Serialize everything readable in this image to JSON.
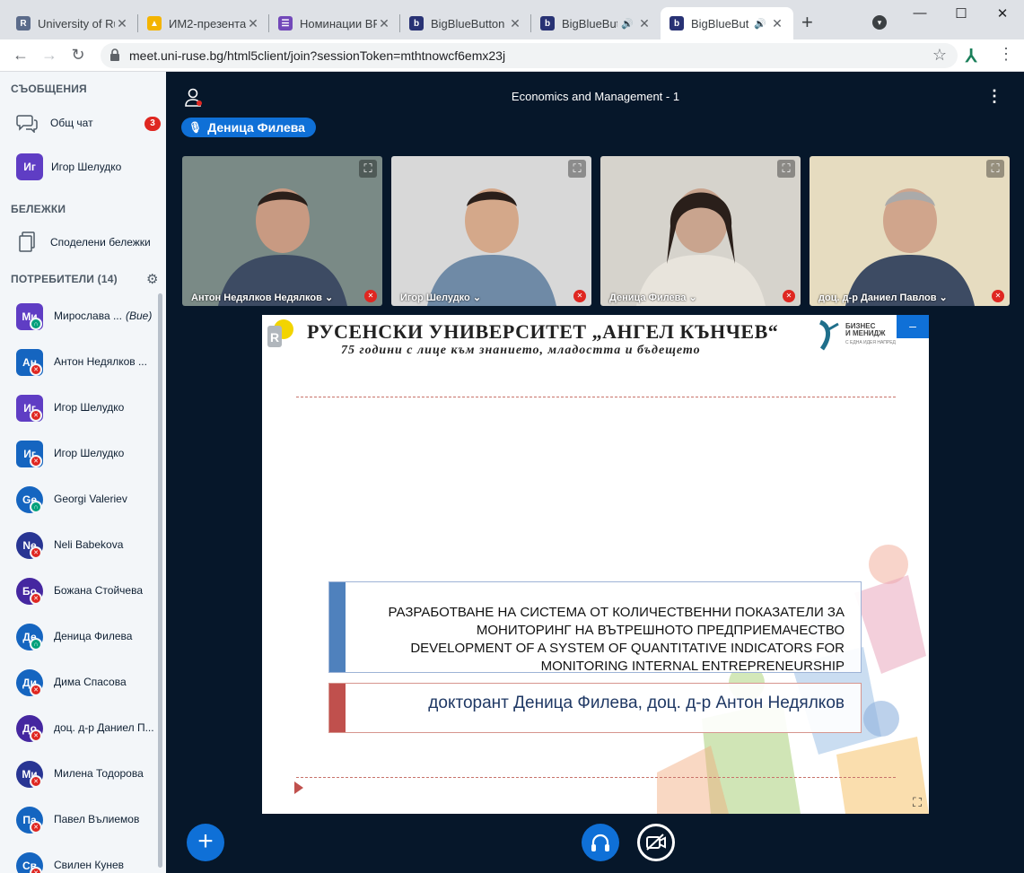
{
  "browser": {
    "tabs": [
      {
        "title": "University of Ru",
        "favicon_color": "#5b6b8a",
        "favicon_text": "R"
      },
      {
        "title": "ИМ2-презента",
        "favicon_color": "#F4B400",
        "favicon_text": "▲"
      },
      {
        "title": "Номинации BP",
        "favicon_color": "#7248B9",
        "favicon_text": "☰"
      },
      {
        "title": "BigBlueButton",
        "favicon_color": "#283274",
        "favicon_text": "b"
      },
      {
        "title": "BigBlueBut",
        "favicon_color": "#283274",
        "favicon_text": "b"
      },
      {
        "title": "BigBlueBut",
        "favicon_color": "#283274",
        "favicon_text": "b"
      }
    ],
    "url": "meet.uni-ruse.bg/html5client/join?sessionToken=mthtnowcf6emx23j"
  },
  "sidebar": {
    "messages_title": "СЪОБЩЕНИЯ",
    "public_chat": "Общ чат",
    "public_chat_badge": "3",
    "private_chat": {
      "initials": "Иг",
      "name": "Игор Шелудко",
      "color": "#5F3DC4"
    },
    "notes_title": "БЕЛЕЖКИ",
    "shared_notes": "Споделени бележки",
    "users_title": "ПОТРЕБИТЕЛИ (14)",
    "users": [
      {
        "initials": "Ми",
        "name": "Мирослава ...",
        "suffix": "(Вие)",
        "color": "#5F3DC4",
        "status": "listen",
        "shape": "square"
      },
      {
        "initials": "Ан",
        "name": "Антон Недялков ...",
        "suffix": "",
        "color": "#1565C0",
        "status": "muted",
        "shape": "square"
      },
      {
        "initials": "Иг",
        "name": "Игор Шелудко",
        "suffix": "",
        "color": "#5F3DC4",
        "status": "muted",
        "shape": "square"
      },
      {
        "initials": "Иг",
        "name": "Игор Шелудко",
        "suffix": "",
        "color": "#1565C0",
        "status": "muted",
        "shape": "square"
      },
      {
        "initials": "Ge",
        "name": "Georgi Valeriev",
        "suffix": "",
        "color": "#1565C0",
        "status": "listen",
        "shape": "circle"
      },
      {
        "initials": "Ne",
        "name": "Neli Babekova",
        "suffix": "",
        "color": "#283593",
        "status": "muted",
        "shape": "circle"
      },
      {
        "initials": "Бо",
        "name": "Божана Стойчева",
        "suffix": "",
        "color": "#4527A0",
        "status": "muted",
        "shape": "circle"
      },
      {
        "initials": "Де",
        "name": "Деница Филева",
        "suffix": "",
        "color": "#1565C0",
        "status": "listen",
        "shape": "circle"
      },
      {
        "initials": "Ди",
        "name": "Дима Спасова",
        "suffix": "",
        "color": "#1565C0",
        "status": "muted",
        "shape": "circle"
      },
      {
        "initials": "До",
        "name": "доц. д-р Даниел П...",
        "suffix": "",
        "color": "#4527A0",
        "status": "muted",
        "shape": "circle"
      },
      {
        "initials": "Ми",
        "name": "Милена Тодорова",
        "suffix": "",
        "color": "#283593",
        "status": "muted",
        "shape": "circle"
      },
      {
        "initials": "Па",
        "name": "Павел Вълиемов",
        "suffix": "",
        "color": "#1565C0",
        "status": "muted",
        "shape": "circle"
      },
      {
        "initials": "Св",
        "name": "Свилен Кунев",
        "suffix": "",
        "color": "#1565C0",
        "status": "muted",
        "shape": "circle"
      }
    ]
  },
  "meeting": {
    "title": "Economics and Management - 1",
    "talker": "Деница Филева",
    "videos": [
      {
        "name": "Антон Недялков Недялков",
        "bg": "#7a8a86",
        "face": "#c89a82"
      },
      {
        "name": "Игор Шелудко",
        "bg": "#d8d8d8",
        "face": "#d4a88a"
      },
      {
        "name": "Деница Филева",
        "bg": "#d6d3cc",
        "face": "#c9a48e"
      },
      {
        "name": "доц. д-р Даниел Павлов",
        "bg": "#e6dcc0",
        "face": "#d0a58c"
      }
    ]
  },
  "slide": {
    "university": "РУСЕНСКИ УНИВЕРСИТЕТ „АНГЕЛ КЪНЧЕВ“",
    "tagline": "75 години с лице към знанието, младостта и бъдещето",
    "brand_line1": "БИЗНЕС",
    "brand_line2": "И МЕНИДЖ",
    "brand_small": "С ЕДНА ИДЕЯ НАПРЕД",
    "title_lines": [
      "РАЗРАБОТВАНЕ НА СИСТЕМА ОТ КОЛИЧЕСТВЕННИ ПОКАЗАТЕЛИ ЗА",
      "МОНИТОРИНГ НА ВЪТРЕШНОТО ПРЕДПРИЕМАЧЕСТВО",
      "DEVELOPMENT OF A SYSTEM OF QUANTITATIVE INDICATORS FOR",
      "MONITORING INTERNAL ENTREPRENEURSHIP"
    ],
    "authors": "докторант Деница Филева, доц. д-р Антон Недялков"
  },
  "colors": {
    "primary": "#0F70D7",
    "muted": "#DF2721",
    "listen": "#00A07B",
    "main_bg": "#06172A"
  }
}
